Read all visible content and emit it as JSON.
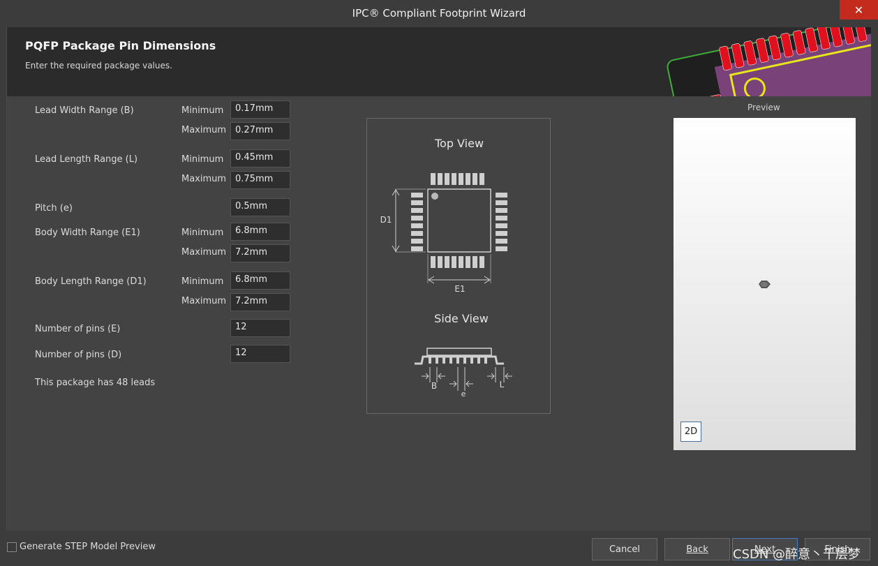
{
  "window": {
    "title": "IPC® Compliant Footprint Wizard",
    "close_glyph": "✕"
  },
  "header": {
    "title": "PQFP Package Pin Dimensions",
    "subtitle": "Enter the required package values."
  },
  "form": {
    "lead_width": {
      "label": "Lead Width Range (B)",
      "min_label": "Minimum",
      "min": "0.17mm",
      "max_label": "Maximum",
      "max": "0.27mm"
    },
    "lead_length": {
      "label": "Lead Length Range (L)",
      "min_label": "Minimum",
      "min": "0.45mm",
      "max_label": "Maximum",
      "max": "0.75mm"
    },
    "pitch": {
      "label": "Pitch (e)",
      "value": "0.5mm"
    },
    "body_width": {
      "label": "Body Width Range (E1)",
      "min_label": "Minimum",
      "min": "6.8mm",
      "max_label": "Maximum",
      "max": "7.2mm"
    },
    "body_length": {
      "label": "Body Length Range (D1)",
      "min_label": "Minimum",
      "min": "6.8mm",
      "max_label": "Maximum",
      "max": "7.2mm"
    },
    "pins_e": {
      "label": "Number of pins (E)",
      "value": "12"
    },
    "pins_d": {
      "label": "Number of pins (D)",
      "value": "12"
    },
    "summary": "This package has 48 leads"
  },
  "diagram": {
    "top_view_label": "Top View",
    "side_view_label": "Side View",
    "d1_label": "D1",
    "e1_label": "E1",
    "b_label": "B",
    "e_label": "e",
    "l_label": "L"
  },
  "preview": {
    "label": "Preview",
    "mode_button": "2D"
  },
  "footer": {
    "step_checkbox_label": "Generate STEP Model Preview",
    "step_checked": false,
    "cancel": "Cancel",
    "back": "Back",
    "next": "Next",
    "finish": "Finish"
  },
  "watermark": "CSDN @醉意丶千层梦",
  "colors": {
    "accent": "#4b7ac0",
    "pad_red": "#e0101e",
    "close_red": "#c42b1c"
  }
}
